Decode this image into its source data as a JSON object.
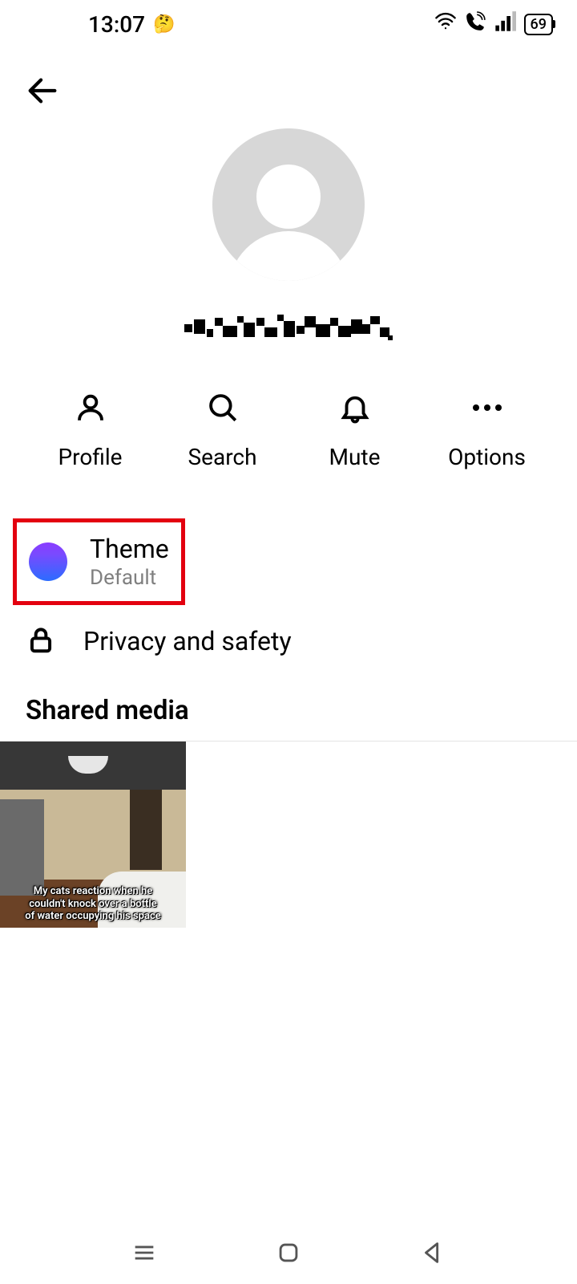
{
  "status": {
    "time": "13:07",
    "battery": "69"
  },
  "actions": {
    "profile": "Profile",
    "search": "Search",
    "mute": "Mute",
    "options": "Options"
  },
  "settings": {
    "theme": {
      "title": "Theme",
      "subtitle": "Default"
    },
    "privacy": {
      "title": "Privacy and safety"
    }
  },
  "shared_media": {
    "header": "Shared media",
    "items": [
      {
        "caption_line1": "My cats reaction when he",
        "caption_line2": "couldn't knock over a bottle",
        "caption_line3": "of water occupying his space"
      }
    ]
  }
}
